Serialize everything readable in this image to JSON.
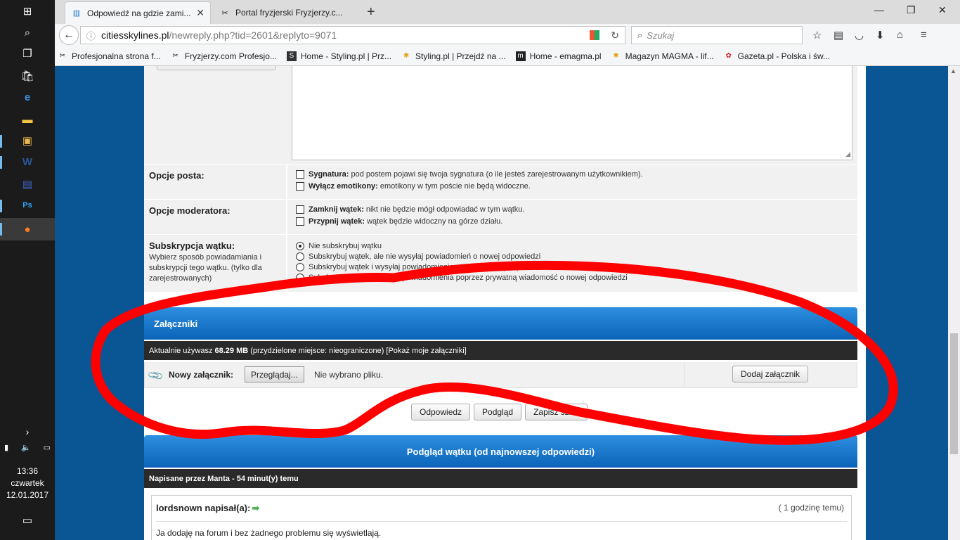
{
  "browser": {
    "tabs": [
      {
        "label": "Odpowiedź na gdzie zami..."
      },
      {
        "label": "Portal fryzjerski Fryzjerzy.c..."
      }
    ],
    "url_domain": "citiesskylines.pl",
    "url_path": "/newreply.php?tid=2601&replyto=9071",
    "search_placeholder": "Szukaj",
    "bookmarks": [
      {
        "label": "Profesjonalna strona f..."
      },
      {
        "label": "Fryzjerzy.com Profesjo..."
      },
      {
        "label": "Home - Styling.pl | Prz..."
      },
      {
        "label": "Styling.pl | Przejdź na ..."
      },
      {
        "label": "Home - emagma.pl"
      },
      {
        "label": "Magazyn MAGMA - lif..."
      },
      {
        "label": "Gazeta.pl - Polska i św..."
      }
    ]
  },
  "taskbar": {
    "time": "13:36",
    "day": "czwartek",
    "date": "12.01.2017"
  },
  "form": {
    "post_options": {
      "label": "Opcje posta:",
      "signature_label": "Sygnatura:",
      "signature_desc": "pod postem pojawi się twoja sygnatura (o ile jesteś zarejestrowanym użytkownikiem).",
      "smilies_label": "Wyłącz emotikony:",
      "smilies_desc": "emotikony w tym poście nie będą widoczne."
    },
    "mod_options": {
      "label": "Opcje moderatora:",
      "close_label": "Zamknij wątek:",
      "close_desc": "nikt nie będzie mógł odpowiadać w tym wątku.",
      "stick_label": "Przypnij wątek:",
      "stick_desc": "wątek będzie widoczny na górze działu."
    },
    "subscription": {
      "label": "Subskrypcja wątku:",
      "desc": "Wybierz sposób powiadamiania i subskrypcji tego wątku. (tylko dla zarejestrowanych)",
      "opt1": "Nie subskrybuj wątku",
      "opt2": "Subskrybuj wątek, ale nie wysyłaj powiadomień o nowej odpowiedzi",
      "opt3": "Subskrybuj wątek i wysyłaj powiadomienia e-mail o nowej odpowiedzi",
      "opt4": "Subskrybuj wątek i wysyłaj powiadomienia poprzez prywatną wiadomość o nowej odpowiedzi"
    }
  },
  "attachments": {
    "title": "Załączniki",
    "usage_prefix": "Aktualnie używasz",
    "usage_value": "68.29 MB",
    "usage_suffix": "(przydzielone miejsce: nieograniczone) [Pokaż moje załączniki]",
    "new_label": "Nowy załącznik:",
    "browse_label": "Przeglądaj...",
    "no_file": "Nie wybrano pliku.",
    "add_label": "Dodaj załącznik"
  },
  "actions": {
    "reply": "Odpowiedz",
    "preview": "Podgląd",
    "save_draft": "Zapisz szkic"
  },
  "thread_preview": {
    "title": "Podgląd wątku (od najnowszej odpowiedzi)",
    "posted_by": "Napisane przez Manta - 54 minut(y) temu",
    "quote_author": "lordsnown napisał(a):",
    "quote_time": "( 1 godzinę temu)",
    "quote_text": "Ja dodaję na forum i bez żadnego problemu się wyświetlają."
  },
  "colors": {
    "page_bg": "#0a5594",
    "header_blue": "#1a78cf",
    "annotation_red": "#ff0000"
  }
}
